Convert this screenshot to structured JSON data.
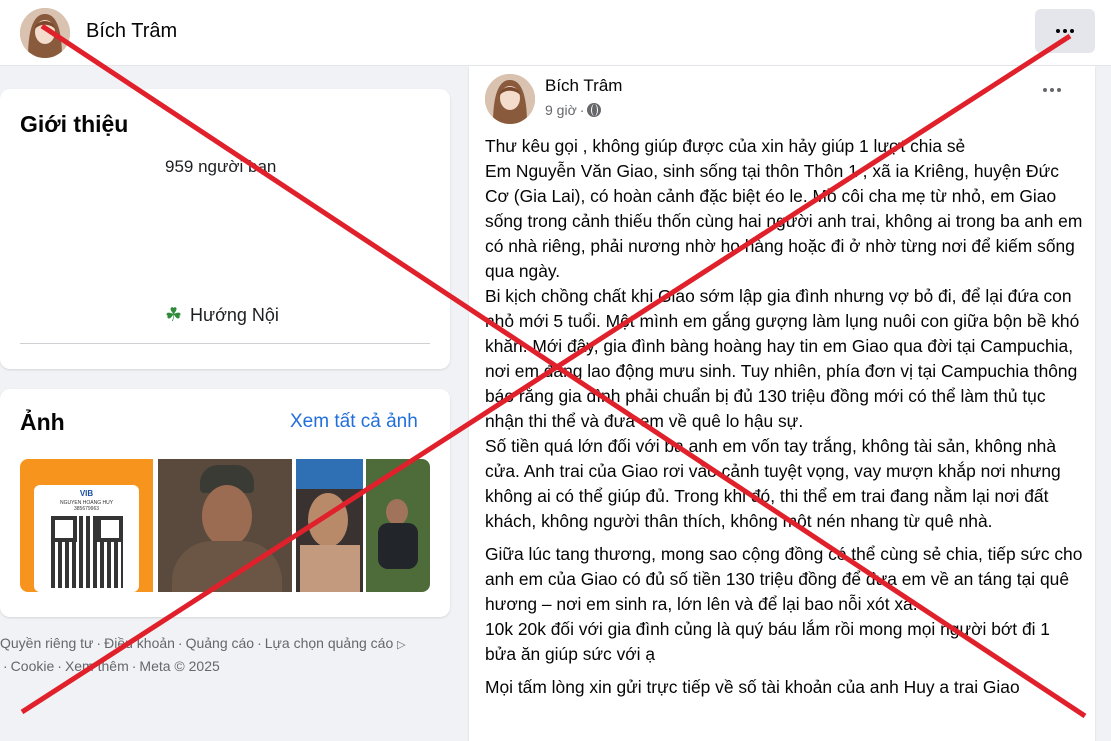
{
  "profile": {
    "name": "Bích Trâm"
  },
  "intro": {
    "title": "Giới thiệu",
    "friends": "959 người bạn",
    "feeling": "Hướng Nội"
  },
  "photos": {
    "title": "Ảnh",
    "see_all": "Xem tất cả ảnh",
    "qr_card": {
      "bank": "VIB",
      "holder": "NGUYEN HOANG HUY",
      "account": "385679963"
    }
  },
  "footer": {
    "links": [
      "Quyền riêng tư",
      "Điều khoản",
      "Quảng cáo",
      "Lựa chọn quảng cáo",
      "Cookie",
      "Xem thêm",
      "Meta © 2025"
    ]
  },
  "post": {
    "author": "Bích Trâm",
    "time": "9 giờ",
    "separator": "·",
    "paragraphs": [
      "Thư kêu gọi , không giúp được của xin hảy giúp 1 lượt chia sẻ\nEm Nguyễn Văn Giao, sinh sống tại thôn Thôn 1 , xã ia Kriêng, huyện Đức Cơ (Gia Lai), có hoàn cảnh đặc biệt éo le. Mồ côi cha mẹ từ nhỏ, em Giao sống trong cảnh thiếu thốn cùng hai người anh trai, không ai trong ba anh em có nhà riêng, phải nương nhờ họ hàng hoặc đi ở nhờ từng nơi để kiếm sống qua ngày.\nBi kịch chồng chất khi Giao sớm lập gia đình nhưng vợ bỏ đi, để lại đứa con nhỏ mới 5 tuổi. Một mình em gắng gượng làm lụng nuôi con giữa bộn bề khó khăn. Mới đây, gia đình bàng hoàng hay tin em Giao qua đời tại Campuchia, nơi em đang lao động mưu sinh. Tuy nhiên, phía đơn vị tại Campuchia thông báo rằng gia đình phải chuẩn bị đủ 130 triệu đồng mới có thể làm thủ tục nhận thi thể và đưa em về quê lo hậu sự.\nSố tiền quá lớn đối với ba anh em vốn tay trắng, không tài sản, không nhà cửa. Anh trai của Giao rơi vào cảnh tuyệt vọng, vay mượn khắp nơi nhưng không ai có thể giúp đủ. Trong khi đó, thi thể em trai đang nằm lại nơi đất khách, không người thân thích, không một nén nhang từ quê nhà.",
      "Giữa lúc tang thương, mong sao cộng đồng có thể cùng sẻ chia, tiếp sức cho anh em của Giao có đủ số tiền 130 triệu đồng để đưa em về an táng tại quê hương – nơi em sinh ra, lớn lên và để lại bao nỗi xót xa.\n10k 20k đối với gia đình củng là quý báu lắm rồi mong mọi người bớt đi 1 bửa ăn giúp sức với ạ",
      "Mọi tấm lòng xin gửi trực tiếp về số tài khoản của anh Huy a trai Giao"
    ]
  },
  "colors": {
    "background": "#f0f2f5",
    "link": "#216fdb",
    "secondary_text": "#65676b",
    "cross": "#e0202a"
  }
}
